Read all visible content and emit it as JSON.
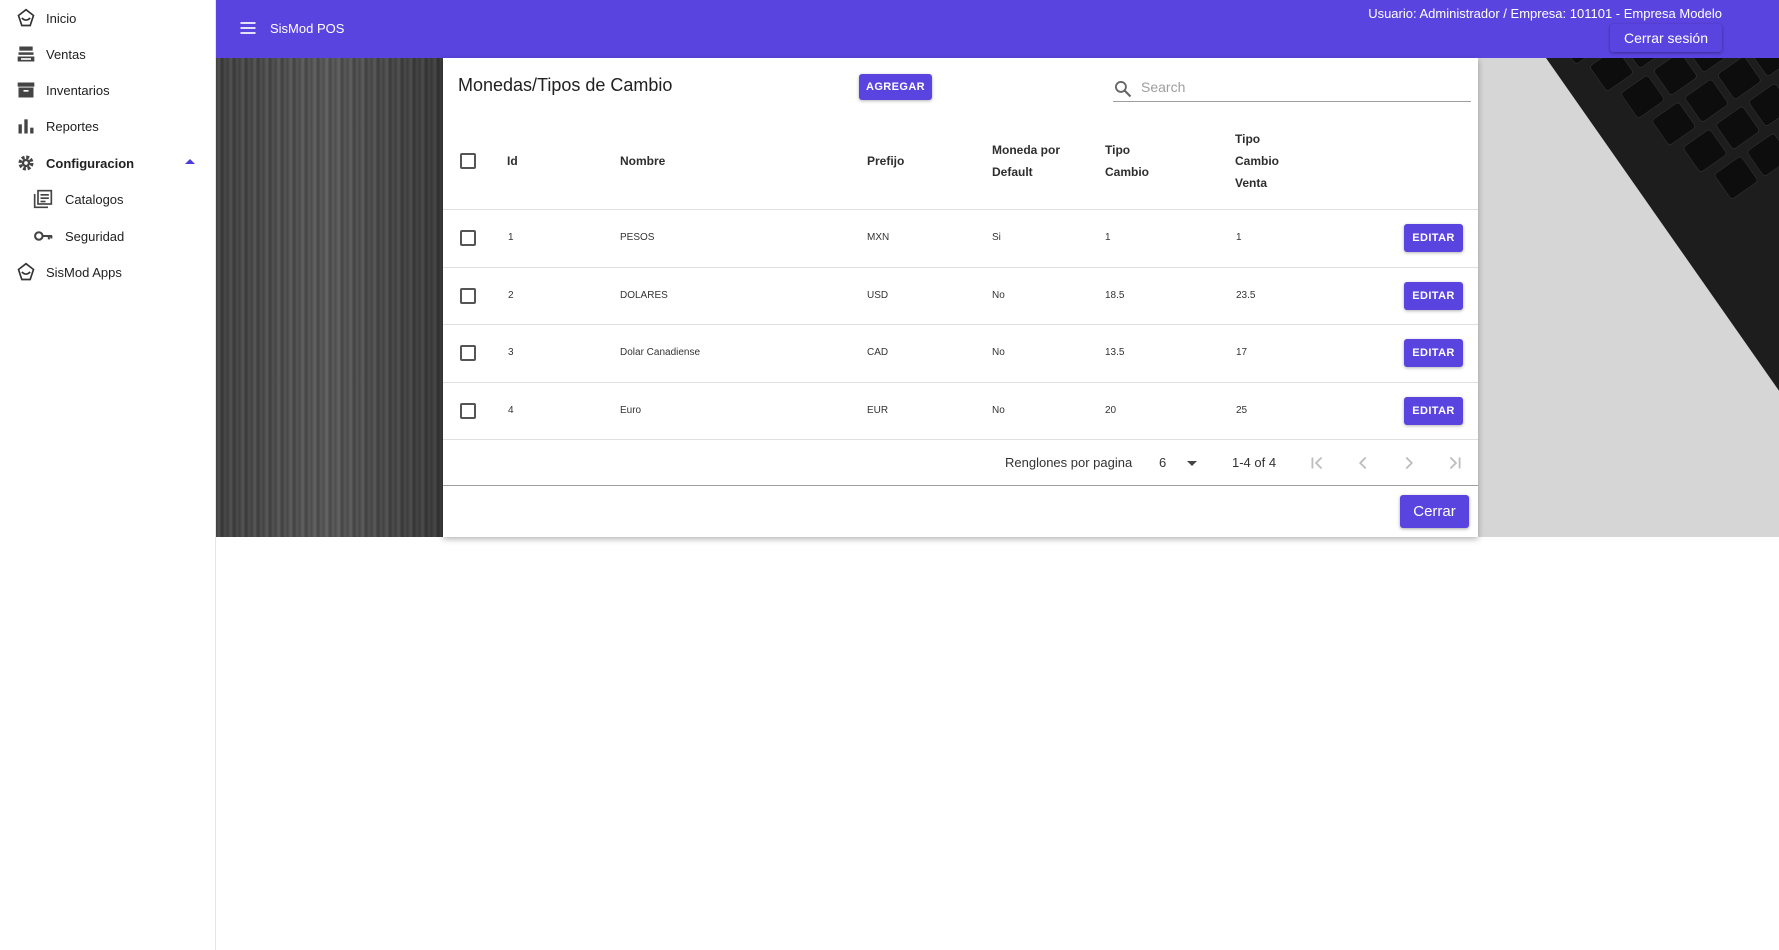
{
  "sidebar": {
    "items": [
      {
        "label": "Inicio",
        "icon": "sismod-logo-icon"
      },
      {
        "label": "Ventas",
        "icon": "cash-register-icon"
      },
      {
        "label": "Inventarios",
        "icon": "archive-box-icon"
      },
      {
        "label": "Reportes",
        "icon": "bar-chart-icon"
      },
      {
        "label": "Configuracion",
        "icon": "gear-icon",
        "expanded": true
      },
      {
        "label": "Catalogos",
        "icon": "library-books-icon"
      },
      {
        "label": "Seguridad",
        "icon": "key-icon"
      },
      {
        "label": "SisMod Apps",
        "icon": "sismod-logo-icon"
      }
    ]
  },
  "appbar": {
    "title": "SisMod POS",
    "user_info": "Usuario: Administrador / Empresa: 101101 - Empresa Modelo",
    "logout_label": "Cerrar sesión",
    "color": "#5a44e0"
  },
  "dialog": {
    "title": "Monedas/Tipos de Cambio",
    "add_label": "AGREGAR",
    "search_placeholder": "Search",
    "search_value": "",
    "columns": {
      "id": "Id",
      "nombre": "Nombre",
      "prefijo": "Prefijo",
      "default_1": "Moneda por",
      "default_2": "Default",
      "tipo_1": "Tipo",
      "tipo_2": "Cambio",
      "venta_1": "Tipo",
      "venta_2": "Cambio",
      "venta_3": "Venta"
    },
    "rows": [
      {
        "id": "1",
        "nombre": "PESOS",
        "prefijo": "MXN",
        "default": "Si",
        "tipo_cambio": "1",
        "tipo_cambio_venta": "1"
      },
      {
        "id": "2",
        "nombre": "DOLARES",
        "prefijo": "USD",
        "default": "No",
        "tipo_cambio": "18.5",
        "tipo_cambio_venta": "23.5"
      },
      {
        "id": "3",
        "nombre": "Dolar Canadiense",
        "prefijo": "CAD",
        "default": "No",
        "tipo_cambio": "13.5",
        "tipo_cambio_venta": "17"
      },
      {
        "id": "4",
        "nombre": "Euro",
        "prefijo": "EUR",
        "default": "No",
        "tipo_cambio": "20",
        "tipo_cambio_venta": "25"
      }
    ],
    "edit_label": "EDITAR",
    "pagination": {
      "rows_per_page_label": "Renglones por pagina",
      "rows_per_page": "6",
      "range": "1-4 of 4"
    },
    "close_label": "Cerrar"
  }
}
